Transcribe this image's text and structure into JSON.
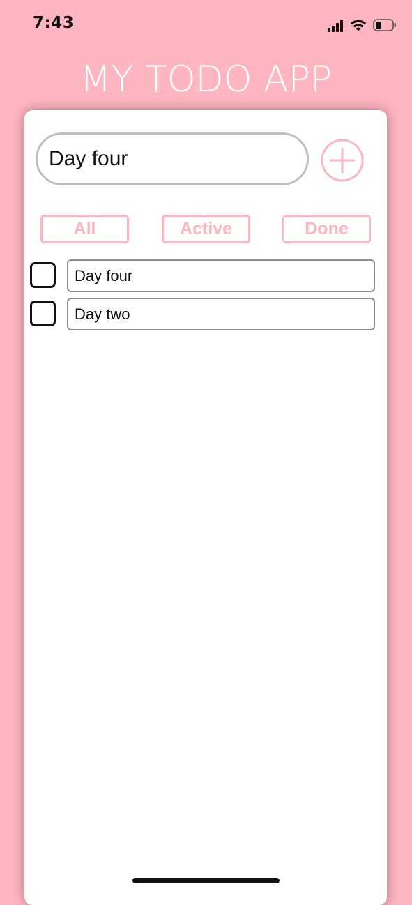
{
  "status_bar": {
    "time": "7:43",
    "icons": [
      "signal-icon",
      "wifi-icon",
      "battery-icon"
    ]
  },
  "app": {
    "title": "MY TODO APP"
  },
  "input": {
    "value": "Day four",
    "placeholder": ""
  },
  "add_button": {
    "icon": "plus-circle-icon"
  },
  "filters": [
    {
      "label": "All"
    },
    {
      "label": "Active"
    },
    {
      "label": "Done"
    }
  ],
  "todos": [
    {
      "text": "Day four",
      "done": false
    },
    {
      "text": "Day two",
      "done": false
    }
  ],
  "colors": {
    "background": "#ffb6c1",
    "accent": "#ffb6c1",
    "card": "#ffffff",
    "text": "#111111"
  }
}
